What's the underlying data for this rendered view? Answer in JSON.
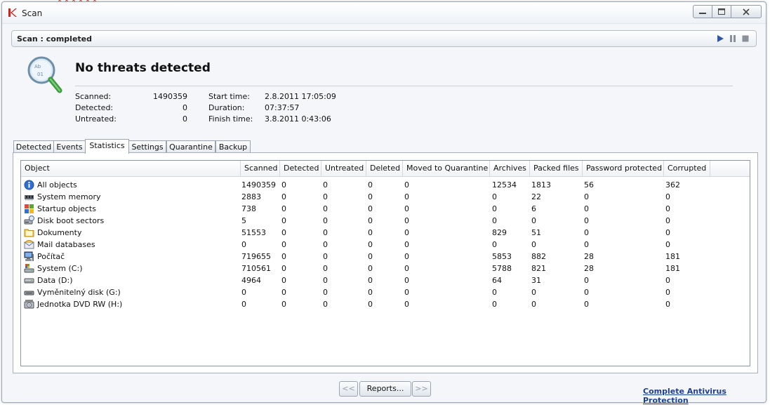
{
  "window": {
    "title": "Scan",
    "accent": "#d0211c"
  },
  "status": {
    "text": "Scan : completed"
  },
  "summary": {
    "headline": "No threats detected",
    "left": [
      {
        "label": "Scanned:",
        "value": "1490359"
      },
      {
        "label": "Detected:",
        "value": "0"
      },
      {
        "label": "Untreated:",
        "value": "0"
      }
    ],
    "right": [
      {
        "label": "Start time:",
        "value": "2.8.2011 17:05:09"
      },
      {
        "label": "Duration:",
        "value": "07:37:57"
      },
      {
        "label": "Finish time:",
        "value": "3.8.2011 0:43:06"
      }
    ]
  },
  "tabs": [
    {
      "label": "Detected",
      "active": false
    },
    {
      "label": "Events",
      "active": false
    },
    {
      "label": "Statistics",
      "active": true
    },
    {
      "label": "Settings",
      "active": false
    },
    {
      "label": "Quarantine",
      "active": false
    },
    {
      "label": "Backup",
      "active": false
    }
  ],
  "table": {
    "columns": [
      "Object",
      "Scanned",
      "Detected",
      "Untreated",
      "Deleted",
      "Moved to Quarantine",
      "Archives",
      "Packed files",
      "Password protected",
      "Corrupted"
    ],
    "rows": [
      {
        "icon": "info-icon",
        "cells": [
          "All objects",
          "1490359",
          "0",
          "0",
          "0",
          "0",
          "12534",
          "1813",
          "56",
          "362"
        ]
      },
      {
        "icon": "memory-icon",
        "cells": [
          "System memory",
          "2883",
          "0",
          "0",
          "0",
          "0",
          "0",
          "22",
          "0",
          "0"
        ]
      },
      {
        "icon": "windows-icon",
        "cells": [
          "Startup objects",
          "738",
          "0",
          "0",
          "0",
          "0",
          "0",
          "6",
          "0",
          "0"
        ]
      },
      {
        "icon": "disk-boot-icon",
        "cells": [
          "Disk boot sectors",
          "5",
          "0",
          "0",
          "0",
          "0",
          "0",
          "0",
          "0",
          "0"
        ]
      },
      {
        "icon": "folder-icon",
        "cells": [
          "Dokumenty",
          "51553",
          "0",
          "0",
          "0",
          "0",
          "829",
          "51",
          "0",
          "0"
        ]
      },
      {
        "icon": "mail-icon",
        "cells": [
          "Mail databases",
          "0",
          "0",
          "0",
          "0",
          "0",
          "0",
          "0",
          "0",
          "0"
        ]
      },
      {
        "icon": "computer-icon",
        "cells": [
          "Počítač",
          "719655",
          "0",
          "0",
          "0",
          "0",
          "5853",
          "882",
          "28",
          "181"
        ]
      },
      {
        "icon": "system-drive-icon",
        "cells": [
          "System (C:)",
          "710561",
          "0",
          "0",
          "0",
          "0",
          "5788",
          "821",
          "28",
          "181"
        ]
      },
      {
        "icon": "hard-drive-icon",
        "cells": [
          "Data (D:)",
          "4964",
          "0",
          "0",
          "0",
          "0",
          "64",
          "31",
          "0",
          "0"
        ]
      },
      {
        "icon": "removable-drive-icon",
        "cells": [
          "Vyměnitelný disk (G:)",
          "0",
          "0",
          "0",
          "0",
          "0",
          "0",
          "0",
          "0",
          "0"
        ]
      },
      {
        "icon": "dvd-drive-icon",
        "cells": [
          "Jednotka DVD RW (H:)",
          "0",
          "0",
          "0",
          "0",
          "0",
          "0",
          "0",
          "0",
          "0"
        ]
      }
    ]
  },
  "nav": {
    "prev": "<<",
    "reports": "Reports...",
    "next": ">>"
  },
  "footer": {
    "link": "Complete Antivirus Protection"
  }
}
